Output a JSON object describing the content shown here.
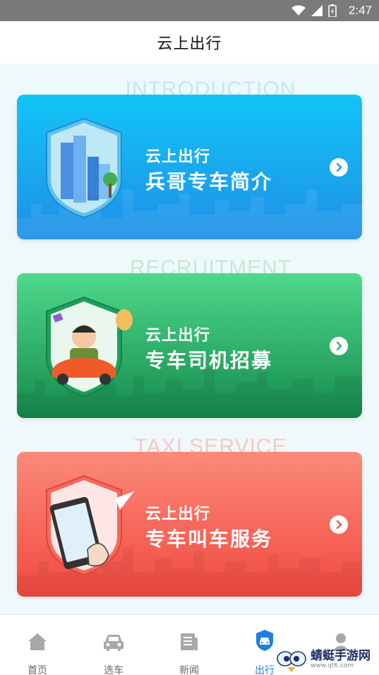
{
  "status_bar": {
    "time": "2:47"
  },
  "header": {
    "title": "云上出行"
  },
  "cards": [
    {
      "watermark": "INTRODUCTION",
      "line1": "云上出行",
      "line2": "兵哥专车简介",
      "watermark_color": "#bfe4f2"
    },
    {
      "watermark": "RECRUITMENT",
      "line1": "云上出行",
      "line2": "专车司机招募",
      "watermark_color": "#bfe8cf"
    },
    {
      "watermark": "TAXI SERVICE",
      "line1": "云上出行",
      "line2": "专车叫车服务",
      "watermark_color": "#f4c6c3"
    }
  ],
  "tabbar": {
    "items": [
      {
        "label": "首页",
        "icon": "home-icon"
      },
      {
        "label": "选车",
        "icon": "car-icon"
      },
      {
        "label": "新闻",
        "icon": "news-icon"
      },
      {
        "label": "出行",
        "icon": "shield-car-icon"
      },
      {
        "label": "",
        "icon": "person-icon"
      }
    ],
    "active": "出行"
  },
  "overlay_logo": {
    "text": "蜻蜓手游网",
    "sub": "www.qt6.com"
  },
  "colors": {
    "accent": "#1e7fe0",
    "card_blue": "#1a9bf0",
    "card_green": "#2cb36b",
    "card_red": "#f5524a"
  }
}
